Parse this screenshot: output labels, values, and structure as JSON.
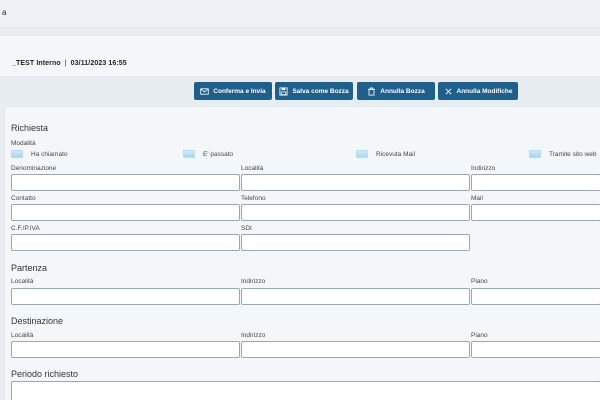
{
  "topbar": {
    "text": "a"
  },
  "info": {
    "user": "_TEST Interno",
    "separator": "|",
    "datetime": "03/11/2023 16:55"
  },
  "actions": {
    "confirm": "Conferma e Invia",
    "save_draft": "Salva come Bozza",
    "cancel_draft": "Annulla Bozza",
    "cancel_changes": "Annulla Modifiche"
  },
  "richiesta": {
    "title": "Richiesta",
    "modalita_label": "Modalità",
    "modalita_options": [
      "Ha chiamato",
      "E' passato",
      "Ricevuta Mail",
      "Tramite sito web"
    ],
    "denominazione": "Denominazione",
    "localita": "Località",
    "indirizzo": "Indirizzo",
    "contatto": "Contatto",
    "telefono": "Telefono",
    "mail": "Mail",
    "cf_piva": "C.F./P.IVA",
    "sdi": "SDI"
  },
  "partenza": {
    "title": "Partenza",
    "localita": "Località",
    "indirizzo": "Indirizzo",
    "piano": "Piano"
  },
  "destinazione": {
    "title": "Destinazione",
    "localita": "Località",
    "indirizzo": "Indirizzo",
    "piano": "Piano"
  },
  "periodo": {
    "title": "Periodo richiesto"
  }
}
